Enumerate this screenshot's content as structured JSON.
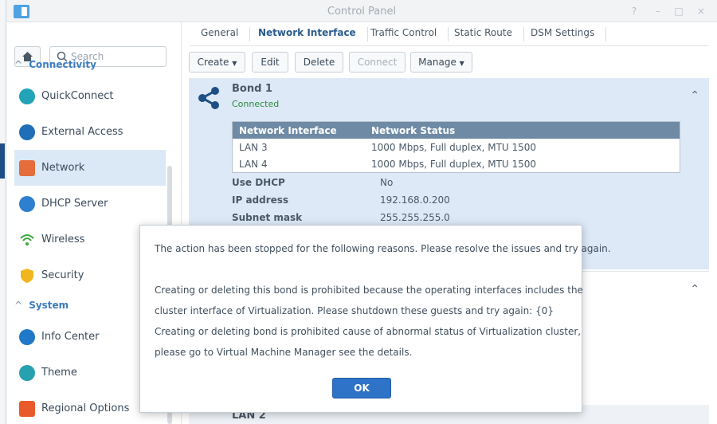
{
  "window": {
    "title": "Control Panel",
    "controls": [
      "?",
      "–",
      "□",
      "×"
    ]
  },
  "sidebar": {
    "search_placeholder": "Search",
    "sections": [
      {
        "label": "Connectivity"
      },
      {
        "label": "System"
      }
    ],
    "items": [
      {
        "label": "QuickConnect",
        "icon": "quickconnect-icon",
        "color": "#23a3b7"
      },
      {
        "label": "External Access",
        "icon": "globe-icon",
        "color": "#1f6fb8"
      },
      {
        "label": "Network",
        "icon": "home-network-icon",
        "color": "#e46d3b"
      },
      {
        "label": "DHCP Server",
        "icon": "dhcp-icon",
        "color": "#2d7fd0"
      },
      {
        "label": "Wireless",
        "icon": "wifi-icon",
        "color": "#3aa83a"
      },
      {
        "label": "Security",
        "icon": "shield-icon",
        "color": "#f2b51e"
      },
      {
        "label": "Info Center",
        "icon": "info-icon",
        "color": "#1f78c8"
      },
      {
        "label": "Theme",
        "icon": "palette-icon",
        "color": "#27a0b0"
      },
      {
        "label": "Regional Options",
        "icon": "clock-flag-icon",
        "color": "#e85a2b"
      }
    ]
  },
  "tabs": [
    "General",
    "Network Interface",
    "Traffic Control",
    "Static Route",
    "DSM Settings"
  ],
  "toolbar": {
    "create": "Create",
    "edit": "Edit",
    "delete": "Delete",
    "connect": "Connect",
    "manage": "Manage"
  },
  "bond": {
    "title": "Bond 1",
    "status": "Connected",
    "table": {
      "headers": [
        "Network Interface",
        "Network Status"
      ],
      "rows": [
        [
          "LAN 3",
          "1000 Mbps, Full duplex, MTU 1500"
        ],
        [
          "LAN 4",
          "1000 Mbps, Full duplex, MTU 1500"
        ]
      ]
    },
    "fields": [
      {
        "key": "Use DHCP",
        "value": "No"
      },
      {
        "key": "IP address",
        "value": "192.168.0.200"
      },
      {
        "key": "Subnet mask",
        "value": "255.255.255.0"
      }
    ]
  },
  "lan2": {
    "title": "LAN 2"
  },
  "dialog": {
    "lines": [
      "The action has been stopped for the following reasons. Please resolve the issues and try again.",
      "Creating or deleting this bond is prohibited because the operating interfaces includes the",
      "cluster interface of Virtualization. Please shutdown these guests and try again: {0}",
      "Creating or deleting bond is prohibited cause of abnormal status of Virtualization cluster,",
      "please go to Virtual Machine Manager see the details."
    ],
    "ok": "OK"
  },
  "colors": {
    "accent": "#2f73c8",
    "selected_bg": "#dbe8f6",
    "panel_bg": "#dde9f7",
    "connected": "#2a8a3a"
  }
}
